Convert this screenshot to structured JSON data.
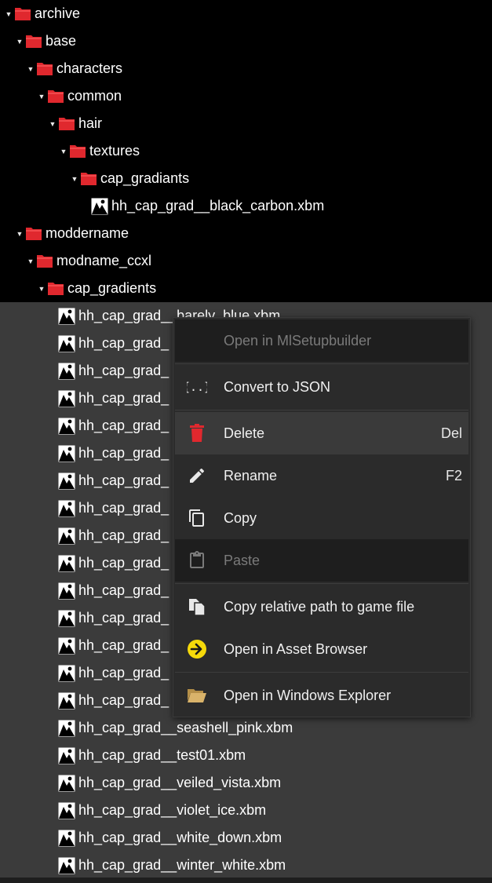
{
  "tree": {
    "folders": [
      {
        "label": "archive",
        "indent": 0
      },
      {
        "label": "base",
        "indent": 1
      },
      {
        "label": "characters",
        "indent": 2
      },
      {
        "label": "common",
        "indent": 3
      },
      {
        "label": "hair",
        "indent": 4
      },
      {
        "label": "textures",
        "indent": 5
      },
      {
        "label": "cap_gradiants",
        "indent": 6
      }
    ],
    "file_under_cap_gradiants": "hh_cap_grad__black_carbon.xbm",
    "folders2": [
      {
        "label": "moddername",
        "indent": 1
      },
      {
        "label": "modname_ccxl",
        "indent": 2
      },
      {
        "label": "cap_gradients",
        "indent": 3
      }
    ],
    "files": [
      "hh_cap_grad__barely_blue.xbm",
      "hh_cap_grad_",
      "hh_cap_grad_",
      "hh_cap_grad_",
      "hh_cap_grad_",
      "hh_cap_grad_",
      "hh_cap_grad_",
      "hh_cap_grad_",
      "hh_cap_grad_",
      "hh_cap_grad_",
      "hh_cap_grad_",
      "hh_cap_grad_",
      "hh_cap_grad_",
      "hh_cap_grad_",
      "hh_cap_grad_",
      "hh_cap_grad__seashell_pink.xbm",
      "hh_cap_grad__test01.xbm",
      "hh_cap_grad__veiled_vista.xbm",
      "hh_cap_grad__violet_ice.xbm",
      "hh_cap_grad__white_down.xbm",
      "hh_cap_grad__winter_white.xbm"
    ]
  },
  "menu": {
    "open_mlsetup": "Open in MlSetupbuilder",
    "convert_json": "Convert to JSON",
    "delete": "Delete",
    "delete_key": "Del",
    "rename": "Rename",
    "rename_key": "F2",
    "copy": "Copy",
    "paste": "Paste",
    "copy_relative": "Copy relative path to game file",
    "open_asset_browser": "Open in Asset Browser",
    "open_explorer": "Open in Windows Explorer"
  },
  "colors": {
    "folder_red": "#e0282e",
    "selection_bg": "#3b3b3b",
    "menu_bg": "#2b2b2b",
    "delete_icon": "#e0282e",
    "asset_browser_icon": "#f5d90a",
    "explorer_folder_icon": "#d9b36a"
  }
}
